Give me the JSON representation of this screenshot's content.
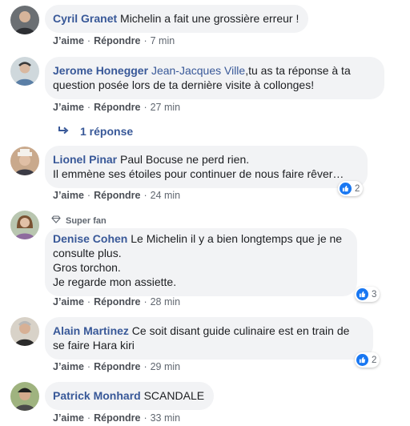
{
  "colors": {
    "link": "#385898",
    "bubble": "#f2f3f5",
    "like": "#1877f2"
  },
  "comments": [
    {
      "author": "Cyril Granet",
      "text": "Michelin a fait une grossière erreur !",
      "like": "J’aime",
      "reply": "Répondre",
      "time": "7 min"
    },
    {
      "author": "Jerome Honegger",
      "tag": "Jean-Jacques Ville",
      "text_line1": ",tu as ta réponse à ta",
      "text_line2": "question posée lors de ta dernière visite à collonges!",
      "like": "J’aime",
      "reply": "Répondre",
      "time": "27 min",
      "replies_label": "1 réponse"
    },
    {
      "author": "Lionel Pinar",
      "text_line1": "Paul Bocuse ne perd rien.",
      "text_line2": "Il emmène ses étoiles pour continuer de nous faire rêver…",
      "like": "J’aime",
      "reply": "Répondre",
      "time": "24 min",
      "reactions": "2"
    },
    {
      "badge": "Super fan",
      "author": "Denise Cohen",
      "text_line1": "Le Michelin il y a bien longtemps que je ne",
      "text_line2": "consulte plus.",
      "text_line3": "Gros torchon.",
      "text_line4": "Je regarde mon assiette.",
      "like": "J’aime",
      "reply": "Répondre",
      "time": "28 min",
      "reactions": "3"
    },
    {
      "author": "Alain Martinez",
      "text_line1": "Ce soit disant guide culinaire est en train de",
      "text_line2": "se faire Hara kiri",
      "like": "J’aime",
      "reply": "Répondre",
      "time": "29 min",
      "reactions": "2"
    },
    {
      "author": "Patrick Monhard",
      "text": "SCANDALE",
      "like": "J’aime",
      "reply": "Répondre",
      "time": "33 min"
    }
  ]
}
